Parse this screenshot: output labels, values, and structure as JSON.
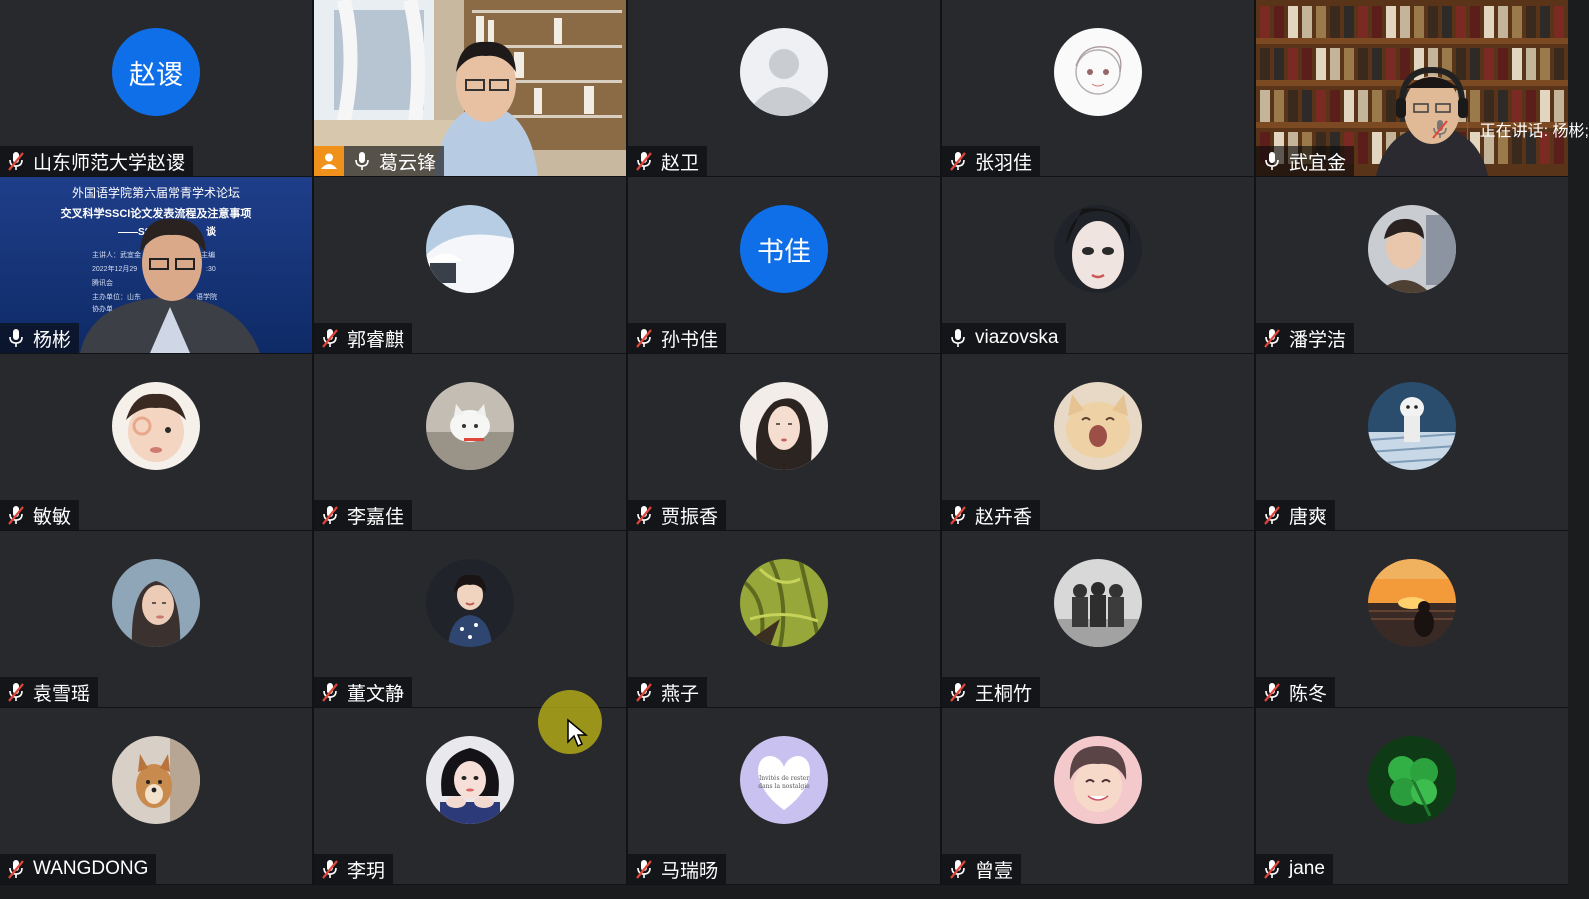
{
  "tiles": [
    {
      "name": "山东师范大学赵谡",
      "type": "text",
      "initials": "赵谡",
      "muted": true
    },
    {
      "name": "葛云锋",
      "type": "video",
      "scene": "library-window",
      "muted": false,
      "cam_badge": true
    },
    {
      "name": "赵卫",
      "type": "default",
      "muted": true
    },
    {
      "name": "张羽佳",
      "type": "photo",
      "scene": "sketch",
      "muted": true
    },
    {
      "name": "武宜金",
      "type": "video",
      "scene": "bookshelf",
      "muted": false
    },
    {
      "name": "杨彬",
      "type": "video",
      "scene": "slide",
      "muted": false
    },
    {
      "name": "郭睿麒",
      "type": "photo",
      "scene": "snow",
      "muted": true
    },
    {
      "name": "孙书佳",
      "type": "text",
      "initials": "书佳",
      "muted": true
    },
    {
      "name": "viazovska",
      "type": "photo",
      "scene": "face-pale",
      "muted": false
    },
    {
      "name": "潘学洁",
      "type": "photo",
      "scene": "boy-station",
      "muted": true
    },
    {
      "name": "敏敏",
      "type": "photo",
      "scene": "child",
      "muted": true
    },
    {
      "name": "李嘉佳",
      "type": "photo",
      "scene": "cat-white",
      "muted": true
    },
    {
      "name": "贾振香",
      "type": "photo",
      "scene": "girl-illustration",
      "muted": true
    },
    {
      "name": "赵卉香",
      "type": "photo",
      "scene": "cat-yawn",
      "muted": true
    },
    {
      "name": "唐爽",
      "type": "photo",
      "scene": "dog-pool",
      "muted": true
    },
    {
      "name": "袁雪瑶",
      "type": "photo",
      "scene": "woman",
      "muted": true
    },
    {
      "name": "董文静",
      "type": "photo",
      "scene": "girl-floral",
      "muted": true
    },
    {
      "name": "燕子",
      "type": "photo",
      "scene": "willow",
      "muted": true
    },
    {
      "name": "王桐竹",
      "type": "photo",
      "scene": "bw-group",
      "muted": true
    },
    {
      "name": "陈冬",
      "type": "photo",
      "scene": "sunset",
      "muted": true
    },
    {
      "name": "WANGDONG",
      "type": "photo",
      "scene": "dog-shiba",
      "muted": true
    },
    {
      "name": "李玥",
      "type": "photo",
      "scene": "girl-hands",
      "muted": true
    },
    {
      "name": "马瑞旸",
      "type": "photo",
      "scene": "heart",
      "muted": true
    },
    {
      "name": "曾壹",
      "type": "photo",
      "scene": "anime-boy",
      "muted": true
    },
    {
      "name": "jane",
      "type": "photo",
      "scene": "clover",
      "muted": true
    }
  ],
  "slide": {
    "title": "外国语学院第六届常青学术论坛",
    "subtitle": "交叉科学SSCI论文发表流程及注意事项",
    "line3": "——SSCI",
    "line3_end": "谈",
    "details": [
      "主讲人：武宜金  Jo",
      "re  总主编",
      "2022年12月29",
      ":30",
      "腾讯会",
      "主办单位：山东",
      "语学院",
      "协办单"
    ]
  },
  "heart_text": "Invités de rester\ndans la nostalgie",
  "speaking": {
    "label": "正在讲话: 杨彬;"
  },
  "colors": {
    "accent": "#0f6fe9",
    "muted_red": "#e0463a",
    "bg": "#27292d"
  }
}
